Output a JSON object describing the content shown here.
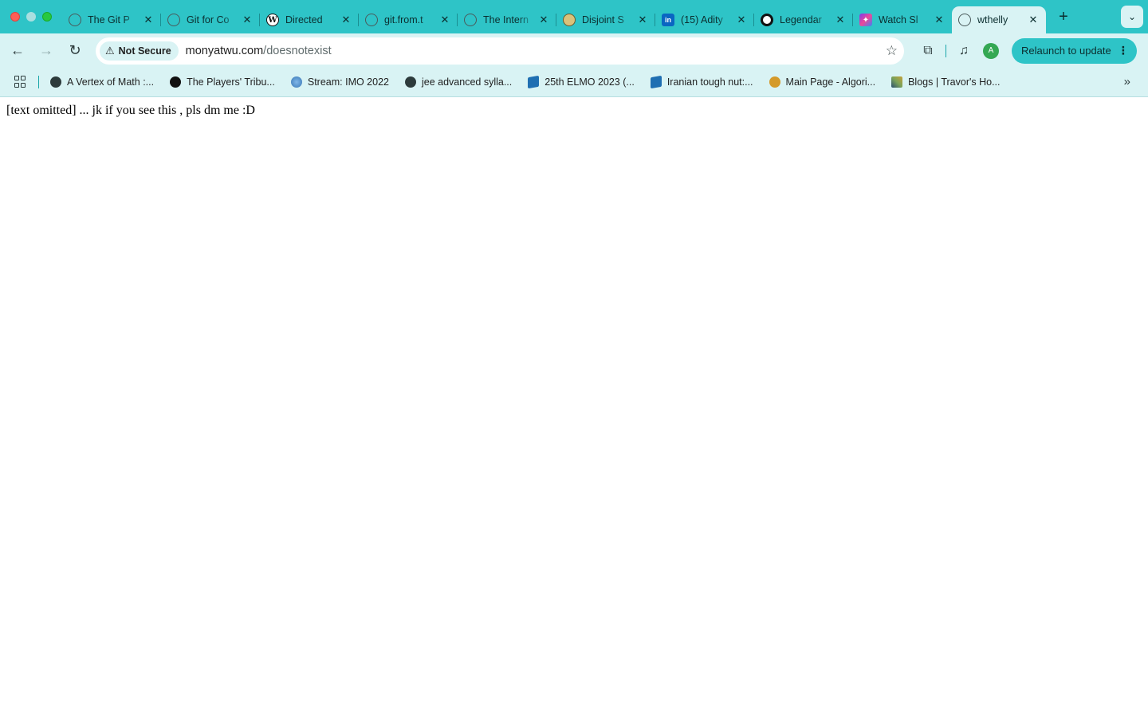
{
  "window": {
    "traffic_lights": [
      "close",
      "minimize",
      "maximize"
    ]
  },
  "tabs": [
    {
      "title": "The Git P",
      "favicon": "globe-icon"
    },
    {
      "title": "Git for Co",
      "favicon": "globe-icon"
    },
    {
      "title": "Directed",
      "favicon": "wikipedia-icon"
    },
    {
      "title": "git.from.t",
      "favicon": "globe-icon"
    },
    {
      "title": "The Intern",
      "favicon": "globe-icon"
    },
    {
      "title": "Disjoint S",
      "favicon": "disjoint-icon"
    },
    {
      "title": "(15) Adity",
      "favicon": "linkedin-icon"
    },
    {
      "title": "Legendar",
      "favicon": "target-icon"
    },
    {
      "title": "Watch Sl",
      "favicon": "watch-icon"
    },
    {
      "title": "wthelly",
      "favicon": "globe-icon",
      "active": true
    }
  ],
  "toolbar": {
    "security_label": "Not Secure",
    "url_host": "monyatwu.com",
    "url_path": "/doesnotexist",
    "avatar_initial": "A",
    "relaunch_label": "Relaunch to update"
  },
  "bookmarks": [
    {
      "label": "A Vertex of Math :...",
      "icon": "globe"
    },
    {
      "label": "The Players' Tribu...",
      "icon": "black"
    },
    {
      "label": "Stream: IMO 2022",
      "icon": "blueorb"
    },
    {
      "label": "jee advanced sylla...",
      "icon": "globe"
    },
    {
      "label": "25th ELMO 2023 (...",
      "icon": "cube"
    },
    {
      "label": "Iranian tough nut:...",
      "icon": "cube"
    },
    {
      "label": "Main Page - Algori...",
      "icon": "lion"
    },
    {
      "label": "Blogs | Travor's Ho...",
      "icon": "mosaic"
    }
  ],
  "page": {
    "body_text": "[text omitted] ... jk if you see this , pls dm me :D"
  },
  "colors": {
    "tab_strip": "#2ec4c7",
    "toolbar": "#d9f3f4",
    "active_tab": "#d9f3f4"
  }
}
